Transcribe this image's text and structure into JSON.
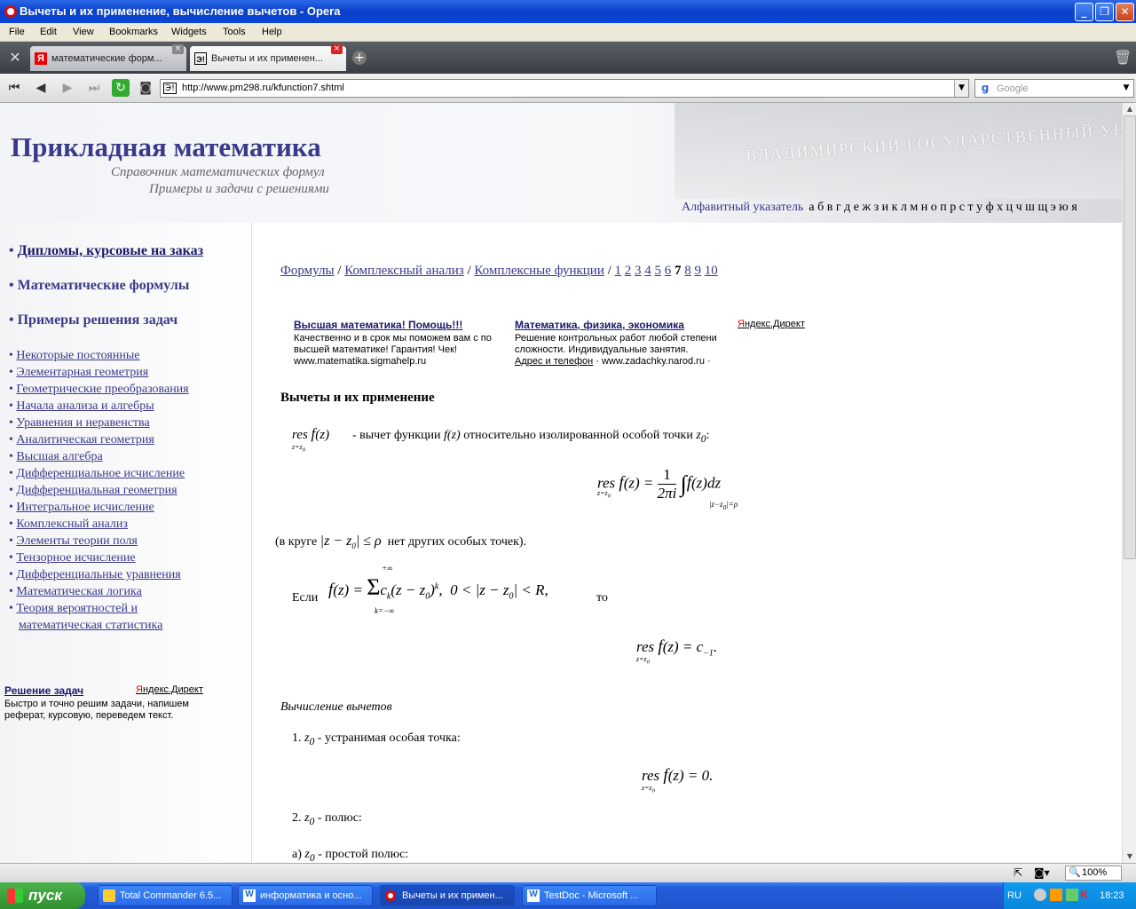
{
  "window": {
    "title": "Вычеты и их применение, вычисление вычетов - Opera"
  },
  "menu": [
    "File",
    "Edit",
    "View",
    "Bookmarks",
    "Widgets",
    "Tools",
    "Help"
  ],
  "tabs": [
    {
      "label": "математические форм...",
      "icon": "Я"
    },
    {
      "label": "Вычеты и их применен...",
      "icon": "Э!"
    }
  ],
  "nav": {
    "url": "http://www.pm298.ru/kfunction7.shtml",
    "search_placeholder": "Google",
    "search_engine": "g"
  },
  "site": {
    "title": "Прикладная математика",
    "subtitle1": "Справочник математических формул",
    "subtitle2": "Примеры и задачи с решениями",
    "alpha_label": "Алфавитный указатель",
    "alpha_letters": "а б в г д е ж з и к л м н о п р с т у ф х ц ч ш щ э ю я",
    "photo_text": "ВЛАДИМИРСКИЙ ГОСУДАРСТВЕННЫЙ УНИВЕРСИТЕТ"
  },
  "sidebar": {
    "main": [
      "Дипломы, курсовые на заказ",
      "Математические формулы",
      "Примеры решения задач"
    ],
    "links": [
      "Некоторые постоянные",
      "Элементарная геометрия",
      "Геометрические преобразования",
      "Начала анализа и алгебры",
      "Уравнения и неравенства",
      "Аналитическая геометрия",
      "Высшая алгебра",
      "Дифференциальное исчисление",
      "Дифференциальная геометрия",
      "Интегральное исчисление",
      "Комплексный анализ",
      "Элементы теории поля",
      "Тензорное исчисление",
      "Дифференциальные уравнения",
      "Математическая логика",
      "Теория вероятностей и",
      "математическая статистика"
    ],
    "ad": {
      "title": "Решение задач",
      "text": "Быстро и точно решим задачи, напишем реферат, курсовую, переведем текст.",
      "yd_y": "Я",
      "yd_rest": "ндекс.Директ"
    }
  },
  "content": {
    "crumbs": [
      "Формулы",
      "Комплексный анализ",
      "Комплексные функции"
    ],
    "sep": "/",
    "pages": [
      "1",
      "2",
      "3",
      "4",
      "5",
      "6",
      "7",
      "8",
      "9",
      "10"
    ],
    "current_page": "7",
    "ads": [
      {
        "title": "Высшая математика! Помощь!!!",
        "text": "Качественно и в срок мы поможем вам с по высшей математике! Гарантия! Чек!",
        "url": "www.matematika.sigmahelp.ru"
      },
      {
        "title": "Математика, физика, экономика",
        "text": "Решение контрольных работ любой степени сложности. Индивидуальные занятия.",
        "contact": "Адрес и телефон",
        "url": "www.zadachky.narod.ru"
      }
    ],
    "yd_y": "Я",
    "yd_rest": "ндекс.Директ",
    "heading": "Вычеты и их применение",
    "p1": "- вычет функции",
    "p1_fz": "f(z)",
    "p1_b": "относительно изолированной особой точки",
    "z0": "z",
    "sub0": "0",
    "p2_a": "(в круге",
    "p2_b": "нет других особых точек).",
    "esli": "Если",
    "to": "то",
    "sub_heading": "Вычисление вычетов",
    "item1": "1.",
    "item1_text": "- устранимая особая точка:",
    "item2": "2.",
    "item2_text": "- полюс:",
    "item2a": "а)",
    "item2a_text": "- простой полюс:"
  },
  "status": {
    "zoom": "100%"
  },
  "taskbar": {
    "start": "пуск",
    "tasks": [
      "Total Commander 6.5...",
      "информатика и осно...",
      "Вычеты и их примен...",
      "TestDoc - Microsoft ..."
    ],
    "lang": "RU",
    "time": "18:23"
  }
}
